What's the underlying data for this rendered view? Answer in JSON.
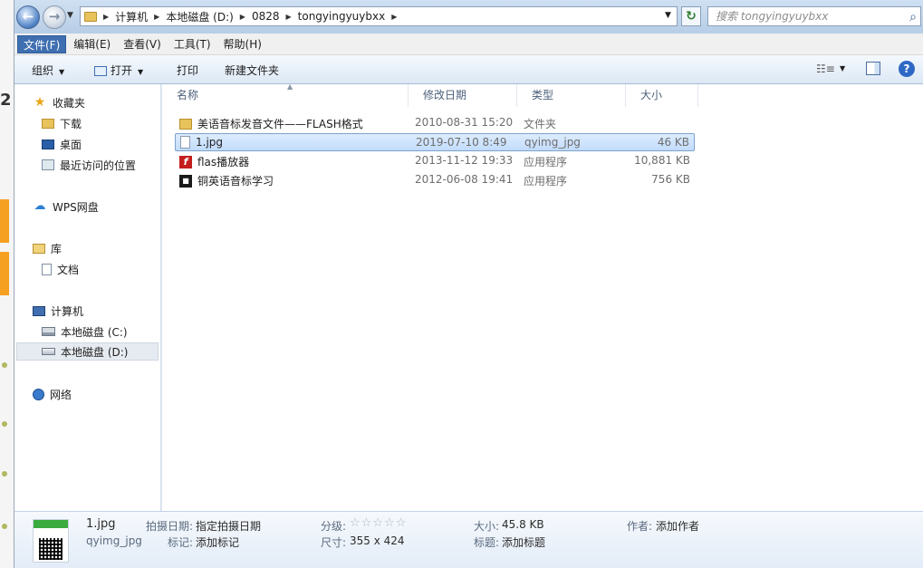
{
  "address": {
    "crumbs": [
      "计算机",
      "本地磁盘 (D:)",
      "0828",
      "tongyingyuybxx"
    ]
  },
  "search": {
    "placeholder": "搜索 tongyingyuybxx"
  },
  "menu": [
    "文件(F)",
    "编辑(E)",
    "查看(V)",
    "工具(T)",
    "帮助(H)"
  ],
  "toolbar": {
    "organize": "组织",
    "open": "打开",
    "print": "打印",
    "new_folder": "新建文件夹"
  },
  "nav": {
    "favorites": "收藏夹",
    "downloads": "下载",
    "desktop": "桌面",
    "recent": "最近访问的位置",
    "wps": "WPS网盘",
    "libraries": "库",
    "documents": "文档",
    "computer": "计算机",
    "drive_c": "本地磁盘 (C:)",
    "drive_d": "本地磁盘 (D:)",
    "network": "网络"
  },
  "columns": {
    "name": "名称",
    "date": "修改日期",
    "type": "类型",
    "size": "大小"
  },
  "files": [
    {
      "name": "美语音标发音文件——FLASH格式",
      "date": "2010-08-31 15:20",
      "type": "文件夹",
      "size": "",
      "icon": "folder-icon"
    },
    {
      "name": "1.jpg",
      "date": "2019-07-10 8:49",
      "type": "qyimg_jpg",
      "size": "46 KB",
      "icon": "file-icon"
    },
    {
      "name": "flas播放器",
      "date": "2013-11-12 19:33",
      "type": "应用程序",
      "size": "10,881 KB",
      "icon": "flash-icon"
    },
    {
      "name": "铜英语音标学习",
      "date": "2012-06-08 19:41",
      "type": "应用程序",
      "size": "756 KB",
      "icon": "app-icon"
    }
  ],
  "details": {
    "filename": "1.jpg",
    "filetype": "qyimg_jpg",
    "date_taken_label": "拍摄日期:",
    "date_taken_value": "指定拍摄日期",
    "tags_label": "标记:",
    "tags_value": "添加标记",
    "rating_label": "分级:",
    "rating_value": 0,
    "dimensions_label": "尺寸:",
    "dimensions_value": "355 x 424",
    "size_label": "大小:",
    "size_value": "45.8 KB",
    "title_label": "标题:",
    "title_value": "添加标题",
    "author_label": "作者:",
    "author_value": "添加作者"
  },
  "colors": {
    "selection": "#c2dcfd",
    "menu_active": "#3f6fb0",
    "window_frame": "#b7cde6"
  }
}
